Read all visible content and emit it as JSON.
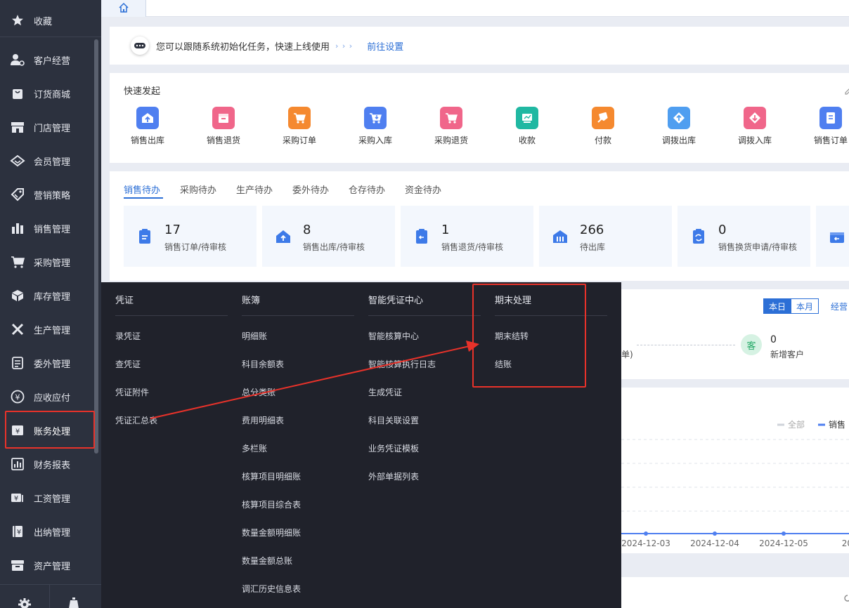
{
  "sidebar": {
    "items": [
      {
        "label": "收藏",
        "icon": "star-icon"
      },
      {
        "label": "客户经营",
        "icon": "user-manage-icon"
      },
      {
        "label": "订货商城",
        "icon": "shopping-bag-icon"
      },
      {
        "label": "门店管理",
        "icon": "store-icon"
      },
      {
        "label": "会员管理",
        "icon": "diamond-icon"
      },
      {
        "label": "营销策略",
        "icon": "tag-icon"
      },
      {
        "label": "销售管理",
        "icon": "bar-chart-icon"
      },
      {
        "label": "采购管理",
        "icon": "cart-icon"
      },
      {
        "label": "库存管理",
        "icon": "box-icon"
      },
      {
        "label": "生产管理",
        "icon": "tools-icon"
      },
      {
        "label": "委外管理",
        "icon": "document-list-icon"
      },
      {
        "label": "应收应付",
        "icon": "yen-circle-icon"
      },
      {
        "label": "账务处理",
        "icon": "yen-ledger-icon"
      },
      {
        "label": "财务报表",
        "icon": "report-icon"
      },
      {
        "label": "工资管理",
        "icon": "salary-icon"
      },
      {
        "label": "出纳管理",
        "icon": "cashier-icon"
      },
      {
        "label": "资产管理",
        "icon": "archive-icon"
      }
    ],
    "bottom_icons": [
      "settings-icon",
      "lamp-icon"
    ]
  },
  "topbar": {
    "home_icon": "home-icon"
  },
  "notice": {
    "text": "您可以跟随系统初始化任务，快速上线使用",
    "dots": "› › ›",
    "link": "前往设置"
  },
  "quick": {
    "title": "快速发起",
    "items": [
      {
        "label": "销售出库",
        "color": "#4f7ff0"
      },
      {
        "label": "销售退货",
        "color": "#f0668a"
      },
      {
        "label": "采购订单",
        "color": "#f5892f"
      },
      {
        "label": "采购入库",
        "color": "#4f7ff0"
      },
      {
        "label": "采购退货",
        "color": "#f0668a"
      },
      {
        "label": "收款",
        "color": "#20b8a2"
      },
      {
        "label": "付款",
        "color": "#f5892f"
      },
      {
        "label": "调拨出库",
        "color": "#4f9ef0"
      },
      {
        "label": "调拨入库",
        "color": "#f0668a"
      },
      {
        "label": "销售订单",
        "color": "#4f7ff0"
      }
    ]
  },
  "todo": {
    "tabs": [
      "销售待办",
      "采购待办",
      "生产待办",
      "委外待办",
      "仓存待办",
      "资金待办"
    ],
    "stats": [
      {
        "value": "17",
        "label": "销售订单/待审核"
      },
      {
        "value": "8",
        "label": "销售出库/待审核"
      },
      {
        "value": "1",
        "label": "销售退货/待审核"
      },
      {
        "value": "266",
        "label": "待出库"
      },
      {
        "value": "0",
        "label": "销售换货申请/待审核"
      }
    ]
  },
  "middle": {
    "seg_today": "本日",
    "seg_month": "本月",
    "link": "经营",
    "partial": "单)",
    "customer_badge": "客",
    "new_customers_value": "0",
    "new_customers_label": "新增客户"
  },
  "chart_data": {
    "type": "line",
    "x": [
      "2024-12-03",
      "2024-12-04",
      "2024-12-05",
      "2024"
    ],
    "series": [
      {
        "name": "销售",
        "values": [
          0,
          0,
          0,
          0
        ]
      }
    ],
    "legend": [
      "全部",
      "销售"
    ],
    "legend_position": "top-right",
    "grid": true
  },
  "dropdown": {
    "columns": [
      {
        "title": "凭证",
        "items": [
          "录凭证",
          "查凭证",
          "凭证附件",
          "凭证汇总表"
        ]
      },
      {
        "title": "账簿",
        "items": [
          "明细账",
          "科目余额表",
          "总分类账",
          "费用明细表",
          "多栏账",
          "核算项目明细账",
          "核算项目综合表",
          "数量金额明细账",
          "数量金额总账",
          "调汇历史信息表"
        ]
      },
      {
        "title": "智能凭证中心",
        "items": [
          "智能核算中心",
          "智能核算执行日志",
          "生成凭证",
          "科目关联设置",
          "业务凭证模板",
          "外部单据列表"
        ]
      },
      {
        "title": "期末处理",
        "items": [
          "期末结转",
          "结账"
        ]
      }
    ]
  },
  "colors": {
    "sidebar_bg": "#2c313e",
    "dropdown_bg": "#20222b",
    "accent": "#2c6fd6",
    "annotation_red": "#e8322a"
  }
}
